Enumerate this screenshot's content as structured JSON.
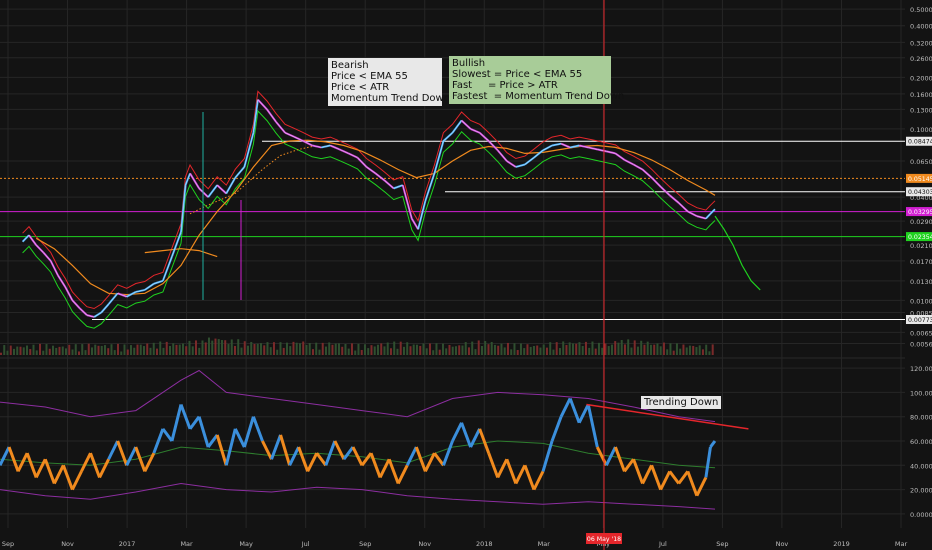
{
  "chart_data": [
    {
      "type": "line",
      "panel": "price",
      "y_axis": "log",
      "ylim": [
        0.0048,
        0.55
      ],
      "y_ticks": [
        "0.500000",
        "0.400000",
        "0.320000",
        "0.260000",
        "0.200000",
        "0.160000",
        "0.130000",
        "0.100000",
        "0.065000",
        "0.040000",
        "0.029000",
        "0.021000",
        "0.017000",
        "0.013000",
        "0.010000",
        "0.008500",
        "0.006500",
        "0.005600"
      ],
      "y_tick_values": [
        0.5,
        0.4,
        0.32,
        0.26,
        0.2,
        0.16,
        0.13,
        0.1,
        0.065,
        0.04,
        0.029,
        0.021,
        0.017,
        0.013,
        0.01,
        0.0085,
        0.0065,
        0.0056
      ],
      "x_ticks": [
        "Sep",
        "Nov",
        "2017",
        "Mar",
        "May",
        "Jul",
        "Sep",
        "Nov",
        "2018",
        "Mar",
        "May",
        "Jul",
        "Sep",
        "Nov",
        "2019",
        "Mar"
      ],
      "price_labels": [
        {
          "text": "0.084742",
          "value": 0.084742,
          "color": "#ffffff",
          "kind": "white"
        },
        {
          "text": "0.051452",
          "value": 0.051452,
          "color": "#f08a1e",
          "kind": "orange"
        },
        {
          "text": "0.043035",
          "value": 0.043035,
          "color": "#ffffff",
          "kind": "white"
        },
        {
          "text": "0.032954",
          "value": 0.032954,
          "color": "#d21fd2",
          "kind": "magenta"
        },
        {
          "text": "0.023549",
          "value": 0.023549,
          "color": "#1fd21f",
          "kind": "green"
        },
        {
          "text": "0.007732",
          "value": 0.007732,
          "color": "#ffffff",
          "kind": "white"
        }
      ],
      "price_path": [
        [
          0.025,
          0.022
        ],
        [
          0.032,
          0.024
        ],
        [
          0.04,
          0.021
        ],
        [
          0.048,
          0.019
        ],
        [
          0.056,
          0.017
        ],
        [
          0.064,
          0.014
        ],
        [
          0.072,
          0.012
        ],
        [
          0.08,
          0.01
        ],
        [
          0.088,
          0.009
        ],
        [
          0.096,
          0.0082
        ],
        [
          0.104,
          0.008
        ],
        [
          0.112,
          0.0085
        ],
        [
          0.12,
          0.0095
        ],
        [
          0.13,
          0.011
        ],
        [
          0.14,
          0.0105
        ],
        [
          0.15,
          0.0112
        ],
        [
          0.16,
          0.0115
        ],
        [
          0.17,
          0.0125
        ],
        [
          0.18,
          0.013
        ],
        [
          0.19,
          0.018
        ],
        [
          0.2,
          0.025
        ],
        [
          0.205,
          0.047
        ],
        [
          0.21,
          0.055
        ],
        [
          0.22,
          0.045
        ],
        [
          0.23,
          0.04
        ],
        [
          0.24,
          0.047
        ],
        [
          0.25,
          0.042
        ],
        [
          0.26,
          0.052
        ],
        [
          0.27,
          0.06
        ],
        [
          0.28,
          0.095
        ],
        [
          0.285,
          0.148
        ],
        [
          0.295,
          0.13
        ],
        [
          0.305,
          0.11
        ],
        [
          0.315,
          0.095
        ],
        [
          0.325,
          0.09
        ],
        [
          0.335,
          0.085
        ],
        [
          0.345,
          0.08
        ],
        [
          0.355,
          0.078
        ],
        [
          0.365,
          0.08
        ],
        [
          0.375,
          0.076
        ],
        [
          0.385,
          0.072
        ],
        [
          0.395,
          0.068
        ],
        [
          0.405,
          0.06
        ],
        [
          0.415,
          0.055
        ],
        [
          0.425,
          0.05
        ],
        [
          0.435,
          0.045
        ],
        [
          0.445,
          0.047
        ],
        [
          0.455,
          0.03
        ],
        [
          0.462,
          0.026
        ],
        [
          0.47,
          0.038
        ],
        [
          0.48,
          0.055
        ],
        [
          0.49,
          0.085
        ],
        [
          0.5,
          0.095
        ],
        [
          0.51,
          0.112
        ],
        [
          0.52,
          0.1
        ],
        [
          0.53,
          0.095
        ],
        [
          0.54,
          0.085
        ],
        [
          0.55,
          0.075
        ],
        [
          0.56,
          0.065
        ],
        [
          0.57,
          0.06
        ],
        [
          0.58,
          0.062
        ],
        [
          0.59,
          0.068
        ],
        [
          0.6,
          0.075
        ],
        [
          0.61,
          0.08
        ],
        [
          0.62,
          0.082
        ],
        [
          0.63,
          0.078
        ],
        [
          0.64,
          0.08
        ],
        [
          0.65,
          0.078
        ],
        [
          0.66,
          0.076
        ],
        [
          0.67,
          0.074
        ],
        [
          0.68,
          0.072
        ],
        [
          0.69,
          0.066
        ],
        [
          0.7,
          0.062
        ],
        [
          0.71,
          0.058
        ],
        [
          0.72,
          0.052
        ],
        [
          0.73,
          0.046
        ],
        [
          0.74,
          0.041
        ],
        [
          0.75,
          0.037
        ],
        [
          0.76,
          0.033
        ],
        [
          0.77,
          0.031
        ],
        [
          0.78,
          0.03
        ],
        [
          0.785,
          0.032
        ],
        [
          0.79,
          0.034
        ]
      ],
      "ema_path": [
        [
          0.04,
          0.023
        ],
        [
          0.06,
          0.02
        ],
        [
          0.08,
          0.016
        ],
        [
          0.1,
          0.0125
        ],
        [
          0.12,
          0.011
        ],
        [
          0.14,
          0.0108
        ],
        [
          0.16,
          0.011
        ],
        [
          0.18,
          0.0125
        ],
        [
          0.2,
          0.016
        ],
        [
          0.22,
          0.024
        ],
        [
          0.24,
          0.033
        ],
        [
          0.26,
          0.043
        ],
        [
          0.28,
          0.06
        ],
        [
          0.3,
          0.08
        ],
        [
          0.32,
          0.085
        ],
        [
          0.34,
          0.086
        ],
        [
          0.36,
          0.084
        ],
        [
          0.38,
          0.08
        ],
        [
          0.4,
          0.074
        ],
        [
          0.42,
          0.066
        ],
        [
          0.44,
          0.058
        ],
        [
          0.46,
          0.052
        ],
        [
          0.48,
          0.055
        ],
        [
          0.5,
          0.065
        ],
        [
          0.52,
          0.075
        ],
        [
          0.54,
          0.079
        ],
        [
          0.56,
          0.077
        ],
        [
          0.58,
          0.072
        ],
        [
          0.6,
          0.073
        ],
        [
          0.62,
          0.076
        ],
        [
          0.64,
          0.079
        ],
        [
          0.66,
          0.08
        ],
        [
          0.68,
          0.078
        ],
        [
          0.7,
          0.073
        ],
        [
          0.72,
          0.066
        ],
        [
          0.74,
          0.058
        ],
        [
          0.76,
          0.05
        ],
        [
          0.78,
          0.044
        ],
        [
          0.79,
          0.041
        ]
      ],
      "orange_dotted_path": [
        [
          0.16,
          0.019
        ],
        [
          0.18,
          0.0195
        ],
        [
          0.2,
          0.02
        ],
        [
          0.22,
          0.0195
        ],
        [
          0.24,
          0.018
        ],
        [
          0.21,
          0.032
        ],
        [
          0.23,
          0.036
        ],
        [
          0.26,
          0.042
        ],
        [
          0.29,
          0.058
        ],
        [
          0.31,
          0.07
        ],
        [
          0.33,
          0.076
        ],
        [
          0.35,
          0.08
        ]
      ],
      "forecast_path": [
        [
          0.79,
          0.031
        ],
        [
          0.8,
          0.026
        ],
        [
          0.81,
          0.021
        ],
        [
          0.82,
          0.016
        ],
        [
          0.83,
          0.013
        ],
        [
          0.84,
          0.0115
        ]
      ]
    },
    {
      "type": "area",
      "panel": "volume",
      "values": [
        0.2,
        0.25,
        0.3,
        0.22,
        0.28,
        0.35,
        0.3,
        0.26,
        0.4,
        0.5,
        0.45,
        0.6,
        0.9,
        0.7,
        0.55,
        0.5,
        0.45,
        0.6,
        0.4,
        0.5,
        0.35,
        0.3,
        0.45,
        0.5,
        0.4,
        0.35,
        0.3,
        0.5,
        0.6,
        0.4,
        0.35,
        0.3,
        0.45,
        0.55,
        0.5,
        0.4,
        0.7,
        0.6,
        0.45,
        0.35,
        0.3,
        0.25
      ]
    },
    {
      "type": "line",
      "panel": "oscillator",
      "ylim": [
        -5,
        125
      ],
      "y_ticks": [
        "120.0000",
        "100.0000",
        "80.0000",
        "60.0000",
        "40.0000",
        "20.0000",
        "0.0000"
      ],
      "y_tick_values": [
        120,
        100,
        80,
        60,
        40,
        20,
        0
      ],
      "upper_band": [
        [
          0.0,
          92
        ],
        [
          0.05,
          88
        ],
        [
          0.1,
          80
        ],
        [
          0.15,
          85
        ],
        [
          0.2,
          110
        ],
        [
          0.22,
          118
        ],
        [
          0.25,
          100
        ],
        [
          0.3,
          95
        ],
        [
          0.35,
          90
        ],
        [
          0.4,
          85
        ],
        [
          0.45,
          80
        ],
        [
          0.5,
          95
        ],
        [
          0.55,
          100
        ],
        [
          0.6,
          98
        ],
        [
          0.65,
          95
        ],
        [
          0.7,
          88
        ],
        [
          0.75,
          80
        ],
        [
          0.79,
          76
        ]
      ],
      "lower_band": [
        [
          0.0,
          20
        ],
        [
          0.05,
          15
        ],
        [
          0.1,
          12
        ],
        [
          0.15,
          18
        ],
        [
          0.2,
          25
        ],
        [
          0.25,
          20
        ],
        [
          0.3,
          18
        ],
        [
          0.35,
          22
        ],
        [
          0.4,
          20
        ],
        [
          0.45,
          15
        ],
        [
          0.5,
          12
        ],
        [
          0.55,
          10
        ],
        [
          0.6,
          8
        ],
        [
          0.65,
          10
        ],
        [
          0.7,
          8
        ],
        [
          0.75,
          6
        ],
        [
          0.79,
          4
        ]
      ],
      "signal": [
        [
          0.0,
          45
        ],
        [
          0.05,
          42
        ],
        [
          0.1,
          40
        ],
        [
          0.15,
          45
        ],
        [
          0.2,
          55
        ],
        [
          0.25,
          52
        ],
        [
          0.3,
          48
        ],
        [
          0.35,
          50
        ],
        [
          0.4,
          47
        ],
        [
          0.45,
          42
        ],
        [
          0.5,
          55
        ],
        [
          0.55,
          60
        ],
        [
          0.6,
          58
        ],
        [
          0.65,
          50
        ],
        [
          0.7,
          45
        ],
        [
          0.75,
          40
        ],
        [
          0.79,
          38
        ]
      ],
      "osc": [
        [
          0.0,
          40
        ],
        [
          0.01,
          55
        ],
        [
          0.02,
          35
        ],
        [
          0.03,
          50
        ],
        [
          0.04,
          30
        ],
        [
          0.05,
          45
        ],
        [
          0.06,
          25
        ],
        [
          0.07,
          40
        ],
        [
          0.08,
          20
        ],
        [
          0.09,
          35
        ],
        [
          0.1,
          50
        ],
        [
          0.11,
          30
        ],
        [
          0.12,
          45
        ],
        [
          0.13,
          60
        ],
        [
          0.14,
          40
        ],
        [
          0.15,
          55
        ],
        [
          0.16,
          35
        ],
        [
          0.17,
          50
        ],
        [
          0.18,
          70
        ],
        [
          0.19,
          60
        ],
        [
          0.2,
          90
        ],
        [
          0.21,
          70
        ],
        [
          0.22,
          80
        ],
        [
          0.23,
          55
        ],
        [
          0.24,
          65
        ],
        [
          0.25,
          40
        ],
        [
          0.26,
          70
        ],
        [
          0.27,
          55
        ],
        [
          0.28,
          80
        ],
        [
          0.29,
          60
        ],
        [
          0.3,
          45
        ],
        [
          0.31,
          65
        ],
        [
          0.32,
          40
        ],
        [
          0.33,
          55
        ],
        [
          0.34,
          35
        ],
        [
          0.35,
          50
        ],
        [
          0.36,
          40
        ],
        [
          0.37,
          60
        ],
        [
          0.38,
          45
        ],
        [
          0.39,
          55
        ],
        [
          0.4,
          40
        ],
        [
          0.41,
          50
        ],
        [
          0.42,
          30
        ],
        [
          0.43,
          45
        ],
        [
          0.44,
          25
        ],
        [
          0.45,
          40
        ],
        [
          0.46,
          55
        ],
        [
          0.47,
          35
        ],
        [
          0.48,
          50
        ],
        [
          0.49,
          40
        ],
        [
          0.5,
          60
        ],
        [
          0.51,
          75
        ],
        [
          0.52,
          55
        ],
        [
          0.53,
          70
        ],
        [
          0.54,
          50
        ],
        [
          0.55,
          30
        ],
        [
          0.56,
          45
        ],
        [
          0.57,
          25
        ],
        [
          0.58,
          40
        ],
        [
          0.59,
          20
        ],
        [
          0.6,
          35
        ],
        [
          0.61,
          60
        ],
        [
          0.62,
          80
        ],
        [
          0.63,
          95
        ],
        [
          0.64,
          75
        ],
        [
          0.65,
          90
        ],
        [
          0.66,
          55
        ],
        [
          0.67,
          40
        ],
        [
          0.68,
          55
        ],
        [
          0.69,
          35
        ],
        [
          0.7,
          45
        ],
        [
          0.71,
          25
        ],
        [
          0.72,
          40
        ],
        [
          0.73,
          20
        ],
        [
          0.74,
          35
        ],
        [
          0.75,
          25
        ],
        [
          0.76,
          35
        ],
        [
          0.77,
          15
        ],
        [
          0.78,
          30
        ],
        [
          0.785,
          55
        ],
        [
          0.79,
          60
        ]
      ],
      "trend_line": [
        [
          0.648,
          90
        ],
        [
          0.827,
          70
        ]
      ]
    }
  ],
  "vline_label": "06 May '18",
  "annotations": {
    "bearish": "Bearish\nPrice < EMA 55\nPrice < ATR\nMomentum Trend Down",
    "bullish": "Bullish\nSlowest = Price < EMA 55\nFast     = Price > ATR\nFastest  = Momentum Trend Down",
    "trending": "Trending Down"
  },
  "colors": {
    "bg": "#131313",
    "grid": "#262626",
    "orange": "#f08a1e",
    "white": "#ffffff",
    "magenta": "#d21fd2",
    "green": "#1fd21f",
    "red": "#e4262b",
    "blue": "#3b8fdc",
    "purple_band": "#8c2ea0",
    "signal": "#2e7d2e"
  }
}
